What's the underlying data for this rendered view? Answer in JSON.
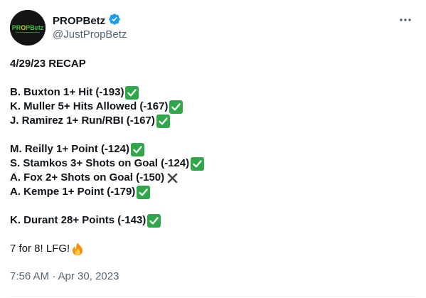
{
  "author": {
    "display_name": "PROPBetz",
    "handle": "@JustPropBetz",
    "verified": true,
    "avatar_text": "PROPBetz",
    "avatar_colors": {
      "background": "#141414",
      "accent_green": "#3fbf3f",
      "accent_yellow": "#f2c315"
    }
  },
  "tweet": {
    "heading": "4/29/23 RECAP",
    "groups": [
      [
        {
          "text": "B. Buxton 1+ Hit (-193)",
          "result": "check"
        },
        {
          "text": "K. Muller 5+ Hits Allowed (-167)",
          "result": "check"
        },
        {
          "text": "J. Ramirez 1+ Run/RBI (-167)",
          "result": "check"
        }
      ],
      [
        {
          "text": "M. Reilly 1+ Point (-124)",
          "result": "check"
        },
        {
          "text": "S. Stamkos 3+ Shots on Goal (-124)",
          "result": "check"
        },
        {
          "text": "A. Fox 2+ Shots on Goal (-150)",
          "result": "cross"
        },
        {
          "text": "A. Kempe 1+ Point (-179)",
          "result": "check"
        }
      ],
      [
        {
          "text": "K. Durant 28+ Points (-143)",
          "result": "check"
        }
      ]
    ],
    "summary": "7 for 8! LFG!",
    "summary_icon": "fire-icon",
    "timestamp": "7:56 AM · Apr 30, 2023"
  },
  "icons": {
    "verified": "verified-badge-icon",
    "more": "more-options-icon",
    "check": "check-mark-icon",
    "cross": "cross-mark-icon"
  },
  "colors": {
    "text": "#0f1419",
    "secondary": "#536471",
    "verified": "#1d9bf0",
    "check_green": "#2fa84a"
  }
}
